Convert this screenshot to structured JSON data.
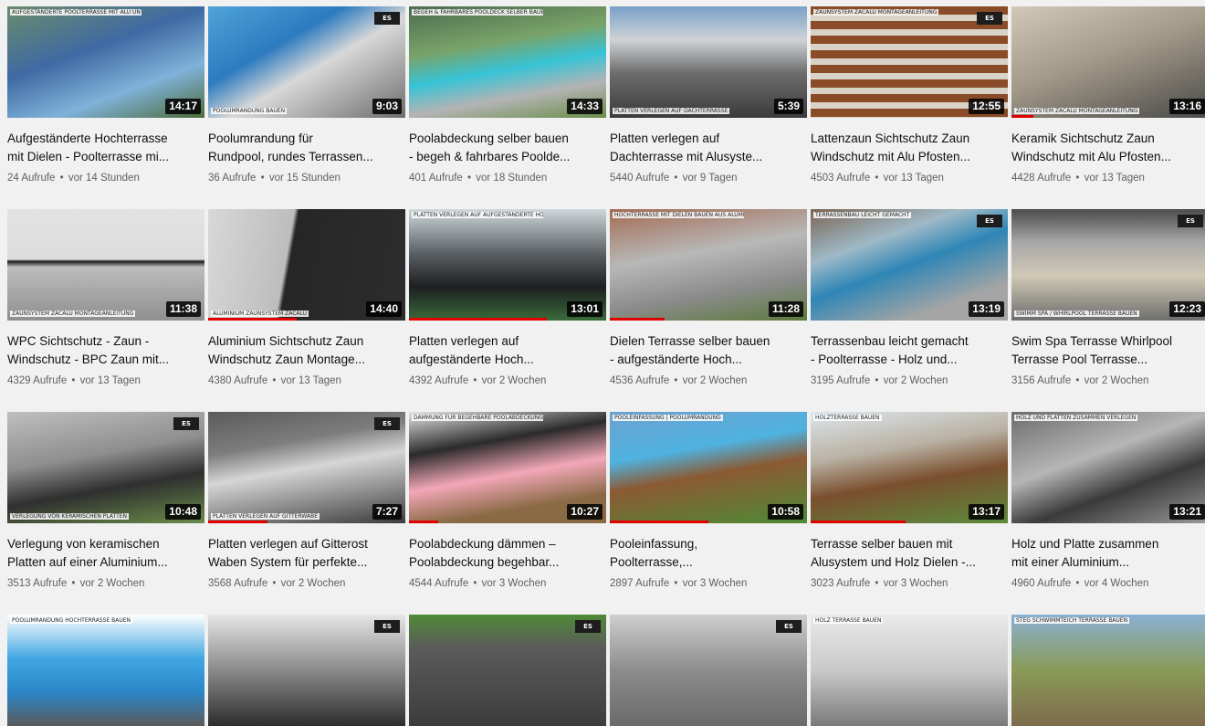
{
  "videos": [
    {
      "title1": "Aufgeständerte Hochterrasse",
      "title2": "mit Dielen - Poolterrasse mi...",
      "views": "24 Aufrufe",
      "age": "vor 14 Stunden",
      "duration": "14:17",
      "overlay": "AUFGESTÄNDERTE POOLTERRASSE MIT ALU UNTERKONSTRUKTION UND DIELEN MONTIERT",
      "logo": ""
    },
    {
      "title1": "Poolumrandung für",
      "title2": "Rundpool, rundes Terrassen...",
      "views": "36 Aufrufe",
      "age": "vor 15 Stunden",
      "duration": "9:03",
      "overlay": "POOLUMRANDUNG BAUEN",
      "logo": "ES"
    },
    {
      "title1": "Poolabdeckung selber bauen",
      "title2": "- begeh & fahrbares Poolde...",
      "views": "401 Aufrufe",
      "age": "vor 18 Stunden",
      "duration": "14:33",
      "overlay": "BEGEH & FAHRBARES POOLDECK SELBER BAUEN",
      "logo": ""
    },
    {
      "title1": "Platten verlegen auf",
      "title2": "Dachterrasse mit Alusyste...",
      "views": "5440 Aufrufe",
      "age": "vor 9 Tagen",
      "duration": "5:39",
      "overlay": "PLATTEN VERLEGEN AUF DACHTERRASSE",
      "logo": ""
    },
    {
      "title1": "Lattenzaun Sichtschutz Zaun",
      "title2": "Windschutz mit Alu Pfosten...",
      "views": "4503 Aufrufe",
      "age": "vor 13 Tagen",
      "duration": "12:55",
      "overlay": "ZAUNSYSTEM ZACALU MONTAGEANLEITUNG",
      "logo": "ES"
    },
    {
      "title1": "Keramik Sichtschutz Zaun",
      "title2": "Windschutz mit Alu Pfosten...",
      "views": "4428 Aufrufe",
      "age": "vor 13 Tagen",
      "duration": "13:16",
      "overlay": "ZAUNSYSTEM ZACALU MONTAGEANLEITUNG",
      "logo": ""
    },
    {
      "title1": "WPC Sichtschutz - Zaun -",
      "title2": "Windschutz - BPC Zaun mit...",
      "views": "4329 Aufrufe",
      "age": "vor 13 Tagen",
      "duration": "11:38",
      "overlay": "ZAUNSYSTEM ZACALU MONTAGEANLEITUNG",
      "logo": ""
    },
    {
      "title1": "Aluminium Sichtschutz Zaun",
      "title2": "Windschutz Zaun Montage...",
      "views": "4380 Aufrufe",
      "age": "vor 13 Tagen",
      "duration": "14:40",
      "overlay": "ALUMINIUM ZAUNSYSTEM ZACALU",
      "logo": ""
    },
    {
      "title1": "Platten verlegen auf",
      "title2": "aufgeständerte Hoch...",
      "views": "4392 Aufrufe",
      "age": "vor 2 Wochen",
      "duration": "13:01",
      "overlay": "PLATTEN VERLEGEN AUF AUFGESTÄNDERTE HOCH TERRASSE",
      "logo": ""
    },
    {
      "title1": "Dielen Terrasse selber bauen",
      "title2": "- aufgeständerte Hoch...",
      "views": "4536 Aufrufe",
      "age": "vor 2 Wochen",
      "duration": "11:28",
      "overlay": "HOCHTERRASSE MIT DIELEN BAUEN AUS ALUMINIUM",
      "logo": ""
    },
    {
      "title1": "Terrassenbau leicht gemacht",
      "title2": "- Poolterrasse - Holz und...",
      "views": "3195 Aufrufe",
      "age": "vor 2 Wochen",
      "duration": "13:19",
      "overlay": "TERRASSENBAU LEICHT GEMACHT",
      "logo": "ES"
    },
    {
      "title1": "Swim Spa Terrasse Whirlpool",
      "title2": "Terrasse Pool Terrasse...",
      "views": "3156 Aufrufe",
      "age": "vor 2 Wochen",
      "duration": "12:23",
      "overlay": "SWIMM SPA / WHIRLPOOL TERRASSE BAUEN",
      "logo": "ES"
    },
    {
      "title1": "Verlegung von keramischen",
      "title2": "Platten auf einer Aluminium...",
      "views": "3513 Aufrufe",
      "age": "vor 2 Wochen",
      "duration": "10:48",
      "overlay": "VERLEGUNG VON KERAMISCHEN PLATTEN",
      "logo": "ES"
    },
    {
      "title1": "Platten verlegen auf Gitterost",
      "title2": "Waben System für perfekte...",
      "views": "3568 Aufrufe",
      "age": "vor 2 Wochen",
      "duration": "7:27",
      "overlay": "PLATTEN VERLEGEN AUF GITTERWABE",
      "logo": "ES"
    },
    {
      "title1": "Poolabdeckung dämmen –",
      "title2": "Poolabdeckung begehbar...",
      "views": "4544 Aufrufe",
      "age": "vor 3 Wochen",
      "duration": "10:27",
      "overlay": "DÄMMUNG FÜR BEGEHBARE POOLABDECKUNGEN",
      "logo": ""
    },
    {
      "title1": "Pooleinfassung,",
      "title2": "Poolterrasse,...",
      "views": "2897 Aufrufe",
      "age": "vor 3 Wochen",
      "duration": "10:58",
      "overlay": "POOLEINFASSUNG | POOLUMRANDUNG",
      "logo": ""
    },
    {
      "title1": "Terrasse selber bauen mit",
      "title2": "Alusystem und Holz Dielen -...",
      "views": "3023 Aufrufe",
      "age": "vor 3 Wochen",
      "duration": "13:17",
      "overlay": "HOLZTERRASSE BAUEN",
      "logo": ""
    },
    {
      "title1": "Holz und Platte zusammen",
      "title2": "mit einer Aluminium...",
      "views": "4960 Aufrufe",
      "age": "vor 4 Wochen",
      "duration": "13:21",
      "overlay": "HOLZ UND PLATTEN ZUSAMMEN VERLEGEN",
      "logo": ""
    },
    {
      "title1": "",
      "title2": "",
      "views": "",
      "age": "",
      "duration": "",
      "overlay": "POOLUMRANDUNG HOCHTERRASSE BAUEN",
      "logo": ""
    },
    {
      "title1": "",
      "title2": "",
      "views": "",
      "age": "",
      "duration": "",
      "overlay": "",
      "logo": "ES"
    },
    {
      "title1": "",
      "title2": "",
      "views": "",
      "age": "",
      "duration": "",
      "overlay": "",
      "logo": "ES"
    },
    {
      "title1": "",
      "title2": "",
      "views": "",
      "age": "",
      "duration": "",
      "overlay": "",
      "logo": "ES"
    },
    {
      "title1": "",
      "title2": "",
      "views": "",
      "age": "",
      "duration": "",
      "overlay": "HOLZ TERRASSE BAUEN",
      "logo": ""
    },
    {
      "title1": "",
      "title2": "",
      "views": "",
      "age": "",
      "duration": "",
      "overlay": "STEG SCHWIMMTEICH TERRASSE BAUEN",
      "logo": ""
    }
  ],
  "colors": {
    "progress": "#e00000",
    "background": "#f1f1f1"
  }
}
